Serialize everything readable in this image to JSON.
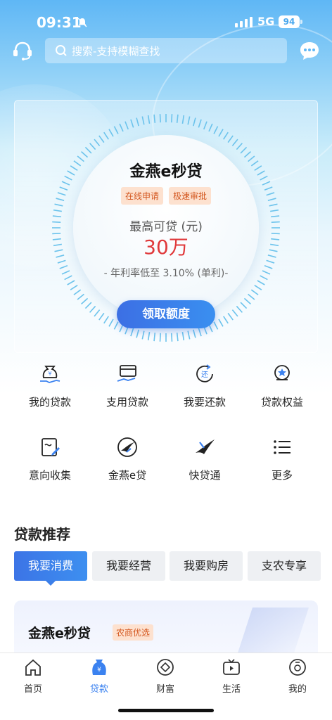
{
  "status_bar": {
    "time": "09:31",
    "network": "5G",
    "battery": "94"
  },
  "header": {
    "search_placeholder": "搜索-支持模糊查找"
  },
  "product": {
    "name": "金燕e秒贷",
    "tags": [
      "在线申请",
      "极速审批"
    ],
    "max_label": "最高可贷 (元)",
    "amount": "30万",
    "rate_note": "- 年利率低至 3.10% (单利)-",
    "apply_button": "领取额度"
  },
  "grid": [
    {
      "label": "我的贷款",
      "icon": "money-bag-hand-icon"
    },
    {
      "label": "支用贷款",
      "icon": "card-hand-icon"
    },
    {
      "label": "我要还款",
      "icon": "repay-icon"
    },
    {
      "label": "贷款权益",
      "icon": "star-badge-icon"
    },
    {
      "label": "意向收集",
      "icon": "form-edit-icon"
    },
    {
      "label": "金燕e贷",
      "icon": "swallow-circle-icon"
    },
    {
      "label": "快贷通",
      "icon": "swallow-icon"
    },
    {
      "label": "更多",
      "icon": "list-icon"
    }
  ],
  "recommend": {
    "title": "贷款推荐",
    "tabs": [
      "我要消费",
      "我要经营",
      "我要购房",
      "支农专享"
    ],
    "active_tab": 0,
    "card_title": "金燕e秒贷",
    "card_tag": "农商优选"
  },
  "bottom_nav": [
    {
      "label": "首页",
      "icon": "home-icon"
    },
    {
      "label": "贷款",
      "icon": "loan-bag-icon"
    },
    {
      "label": "财富",
      "icon": "wealth-icon"
    },
    {
      "label": "生活",
      "icon": "tv-icon"
    },
    {
      "label": "我的",
      "icon": "profile-icon"
    }
  ],
  "colors": {
    "accent": "#3b82f0",
    "amount": "#e0393b",
    "tag_bg": "#fde1cf",
    "tag_text": "#d3561e"
  }
}
